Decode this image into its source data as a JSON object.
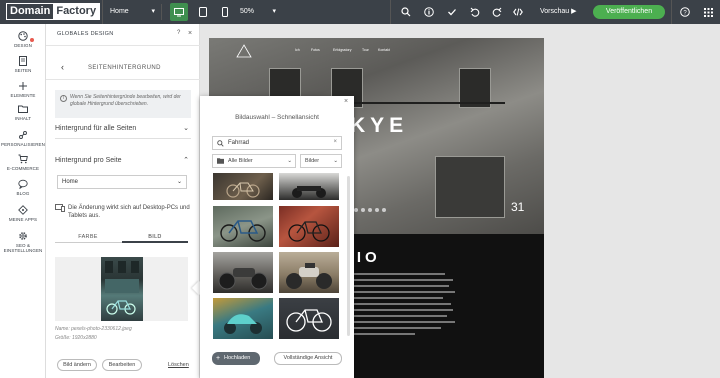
{
  "topbar": {
    "logo_part1": "Domain",
    "logo_part2": "Factory",
    "page_select": "Home",
    "zoom": "50%",
    "preview": "Vorschau",
    "publish": "Veröffentlichen",
    "icons": [
      "desktop-icon",
      "tablet-icon",
      "phone-icon",
      "search-icon",
      "info-icon",
      "check-icon",
      "undo-icon",
      "redo-icon",
      "code-icon",
      "help-icon"
    ]
  },
  "iconbar": {
    "items": [
      {
        "label": "DESIGN",
        "icon": "palette-icon"
      },
      {
        "label": "SEITEN",
        "icon": "pages-icon"
      },
      {
        "label": "ELEMENTE",
        "icon": "plus-icon"
      },
      {
        "label": "INHALT",
        "icon": "folder-icon"
      },
      {
        "label": "PERSONALISIEREN",
        "icon": "personalize-icon"
      },
      {
        "label": "E-COMMERCE",
        "icon": "cart-icon"
      },
      {
        "label": "BLOG",
        "icon": "chat-icon"
      },
      {
        "label": "MEINE APPS",
        "icon": "apps-icon"
      },
      {
        "label": "SEO &",
        "label2": "EINSTELLUNGEN",
        "icon": "gear-icon"
      }
    ]
  },
  "panel": {
    "title": "GLOBALES DESIGN",
    "help": "?",
    "close": "×",
    "subtitle": "SEITENHINTERGRUND",
    "info": "Wenn Sie Seitenhintergründe bearbeiten, wird der globale Hintergrund überschrieben.",
    "acc_all": "Hintergrund für alle Seiten",
    "acc_per_page": "Hintergrund pro Seite",
    "page_value": "Home",
    "device_note": "Die Änderung wirkt sich auf Desktop-PCs und Tablets aus.",
    "tab_color": "FARBE",
    "tab_image": "BILD",
    "file_name": "Name: pexels-photo-2330612.jpeg",
    "file_size": "Größe: 1920x2880",
    "change_image": "Bild ändern",
    "edit": "Bearbeiten",
    "delete": "Löschen"
  },
  "site": {
    "nav": [
      "Ich",
      "Fotos",
      "Erfolgsstory",
      "Tour",
      "Kontakt"
    ],
    "hero_title": "KYE",
    "bio_title": "BIO",
    "house_number": "31"
  },
  "picker": {
    "title": "Bildauswahl – Schnellansicht",
    "close": "×",
    "search_value": "Fahrrad",
    "filter_source": "Alle Bilder",
    "filter_type": "Bilder",
    "upload": "Hochladen",
    "full_view": "Vollständige Ansicht"
  },
  "colors": {
    "topbar": "#3b4148",
    "publish": "#4caf50",
    "desktop_active": "#3f8f4f",
    "notification_dot": "#e85a4f"
  }
}
